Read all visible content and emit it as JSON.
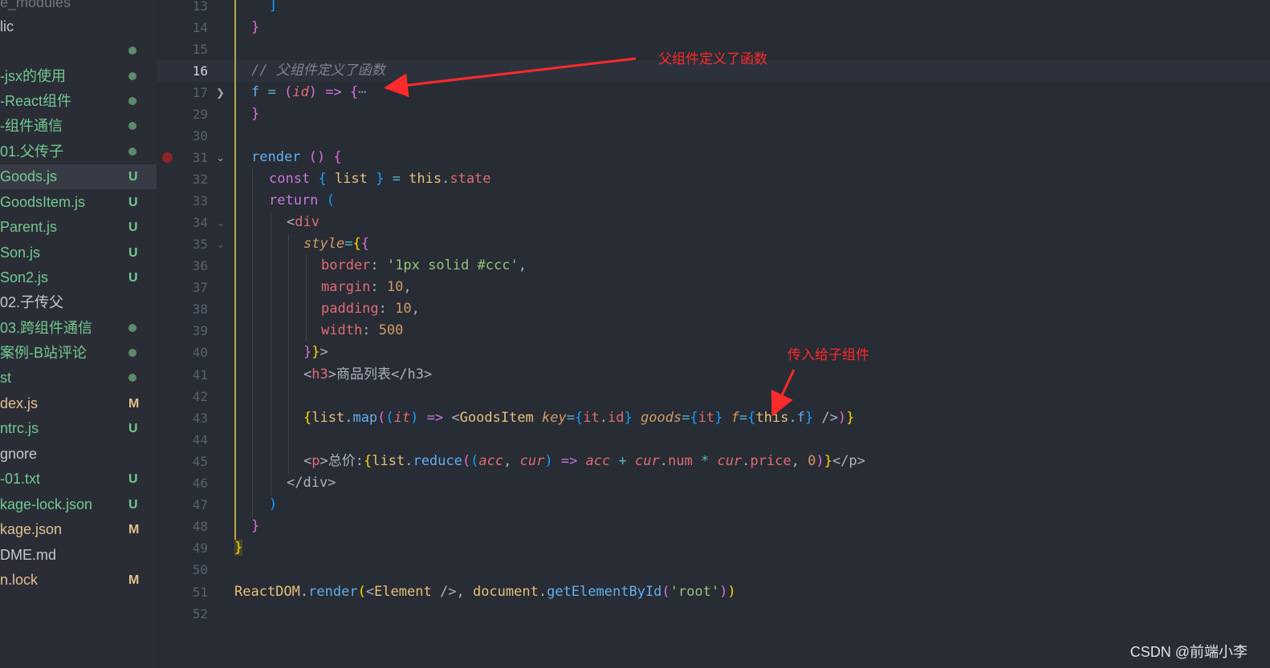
{
  "sidebar": {
    "items": [
      {
        "label": "e_modules",
        "color": "#707582",
        "status": "",
        "status_color": "",
        "dot": false
      },
      {
        "label": "lic",
        "color": "#c3c7ce",
        "status": "",
        "status_color": "",
        "dot": false
      },
      {
        "label": "",
        "color": "#c3c7ce",
        "status": "",
        "status_color": "",
        "dot": true
      },
      {
        "label": "-jsx的使用",
        "color": "#73c990",
        "status": "",
        "status_color": "",
        "dot": true
      },
      {
        "label": "-React组件",
        "color": "#73c990",
        "status": "",
        "status_color": "",
        "dot": true
      },
      {
        "label": "-组件通信",
        "color": "#73c990",
        "status": "",
        "status_color": "",
        "dot": true
      },
      {
        "label": "01.父传子",
        "color": "#73c990",
        "status": "",
        "status_color": "",
        "dot": true
      },
      {
        "label": " Goods.js",
        "color": "#73c990",
        "status": "U",
        "status_color": "#73c990",
        "dot": false,
        "selected": true
      },
      {
        "label": " GoodsItem.js",
        "color": "#73c990",
        "status": "U",
        "status_color": "#73c990",
        "dot": false
      },
      {
        "label": " Parent.js",
        "color": "#73c990",
        "status": "U",
        "status_color": "#73c990",
        "dot": false
      },
      {
        "label": " Son.js",
        "color": "#73c990",
        "status": "U",
        "status_color": "#73c990",
        "dot": false
      },
      {
        "label": " Son2.js",
        "color": "#73c990",
        "status": "U",
        "status_color": "#73c990",
        "dot": false
      },
      {
        "label": "02.子传父",
        "color": "#c3c7ce",
        "status": "",
        "status_color": "",
        "dot": false
      },
      {
        "label": "03.跨组件通信",
        "color": "#73c990",
        "status": "",
        "status_color": "",
        "dot": true
      },
      {
        "label": "案例-B站评论",
        "color": "#73c990",
        "status": "",
        "status_color": "",
        "dot": true
      },
      {
        "label": "st",
        "color": "#73c990",
        "status": "",
        "status_color": "",
        "dot": true
      },
      {
        "label": "dex.js",
        "color": "#e2c08d",
        "status": "M",
        "status_color": "#e2c08d",
        "dot": false
      },
      {
        "label": "ntrc.js",
        "color": "#73c990",
        "status": "U",
        "status_color": "#73c990",
        "dot": false
      },
      {
        "label": "gnore",
        "color": "#c3c7ce",
        "status": "",
        "status_color": "",
        "dot": false
      },
      {
        "label": "-01.txt",
        "color": "#73c990",
        "status": "U",
        "status_color": "#73c990",
        "dot": false
      },
      {
        "label": "kage-lock.json",
        "color": "#73c990",
        "status": "U",
        "status_color": "#73c990",
        "dot": false
      },
      {
        "label": "kage.json",
        "color": "#e2c08d",
        "status": "M",
        "status_color": "#e2c08d",
        "dot": false
      },
      {
        "label": "DME.md",
        "color": "#c3c7ce",
        "status": "",
        "status_color": "",
        "dot": false
      },
      {
        "label": "n.lock",
        "color": "#e2c08d",
        "status": "M",
        "status_color": "#e2c08d",
        "dot": false
      }
    ]
  },
  "editor": {
    "line_numbers": [
      "13",
      "14",
      "15",
      "16",
      "17",
      "29",
      "30",
      "31",
      "32",
      "33",
      "34",
      "35",
      "36",
      "37",
      "38",
      "39",
      "40",
      "41",
      "42",
      "43",
      "44",
      "45",
      "46",
      "47",
      "48",
      "49",
      "50",
      "51",
      "52"
    ],
    "active_line": "16",
    "t": {
      "close_bracket": "]",
      "close_brace": "}",
      "comment": "// 父组件定义了函数",
      "f": "f",
      "eq": "=",
      "paren_open": "(",
      "paren_close": ")",
      "id": "id",
      "arrow": "=>",
      "brace_open": "{",
      "ellipsis": "⋯",
      "render": "render",
      "const": "const",
      "list": "list",
      "this": "this",
      "dot": ".",
      "state": "state",
      "return": "return",
      "lt": "<",
      "gt": ">",
      "div": "div",
      "style": "style",
      "border": "border",
      "border_val": "'1px solid #ccc'",
      "margin": "margin",
      "padding": "padding",
      "width": "width",
      "colon": ":",
      "comma": ",",
      "ten": "10",
      "five_hundred": "500",
      "h3": "h3",
      "h3_text": "商品列表",
      "map": "map",
      "it": "it",
      "goodsitem": "GoodsItem",
      "key": "key",
      "goods": "goods",
      "selfclose": "/>",
      "p": "p",
      "p_text": "总价:",
      "reduce": "reduce",
      "acc": "acc",
      "cur": "cur",
      "plus": "+",
      "num": "num",
      "star": "*",
      "price": "price",
      "zero": "0",
      "close_div": "</div>",
      "close_p": "</p>",
      "close_h3": "</h3>",
      "reactdom": "ReactDOM",
      "element": "Element",
      "document": "document",
      "getbyid": "getElementById",
      "root": "'root'"
    }
  },
  "annotations": {
    "parent_defined_fn": "父组件定义了函数",
    "pass_to_child": "传入给子组件",
    "color": "#ff2a2a"
  },
  "watermark": "CSDN @前端小李"
}
